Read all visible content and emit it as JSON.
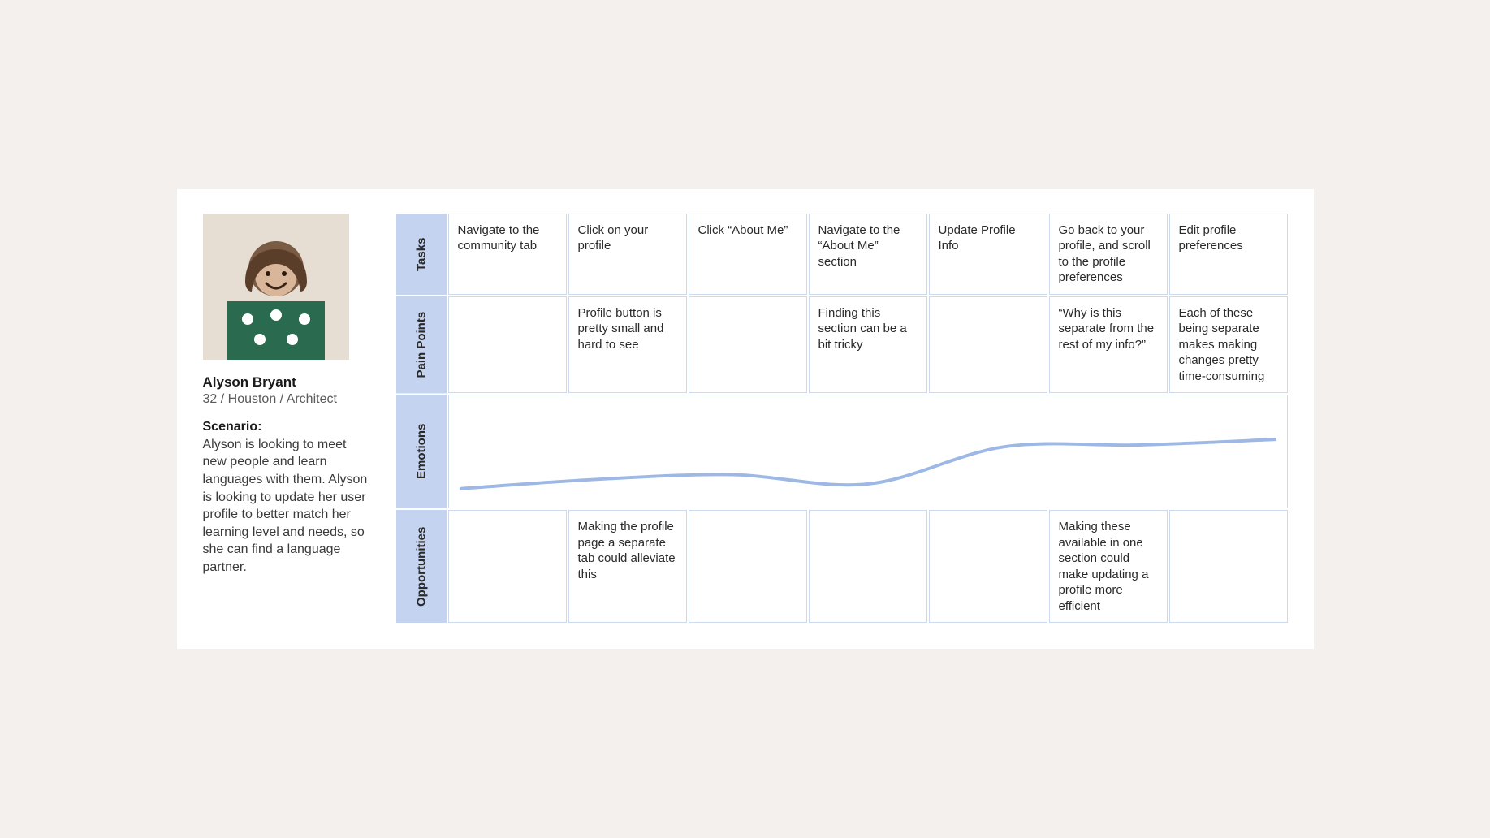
{
  "persona": {
    "name": "Alyson Bryant",
    "meta": "32 / Houston / Architect",
    "scenario_label": "Scenario:",
    "scenario_text": "Alyson is looking to meet new people and learn languages with them. Alyson is looking to update her user profile to better match her learning level and needs, so she can find a language partner."
  },
  "rows": {
    "tasks_label": "Tasks",
    "pain_label": "Pain Points",
    "emotions_label": "Emotions",
    "opportunities_label": "Opportunities"
  },
  "columns": [
    {
      "task": "Navigate to the community tab",
      "pain": "",
      "opportunity": ""
    },
    {
      "task": "Click on your profile",
      "pain": "Profile button is pretty small and hard to see",
      "opportunity": "Making the profile page a separate tab could alleviate this"
    },
    {
      "task": "Click “About Me”",
      "pain": "",
      "opportunity": ""
    },
    {
      "task": "Navigate to the “About Me” section",
      "pain": "Finding this section can be a bit tricky",
      "opportunity": ""
    },
    {
      "task": "Update Profile Info",
      "pain": "",
      "opportunity": ""
    },
    {
      "task": "Go back to your profile, and scroll to the profile preferences",
      "pain": "“Why is this separate from the rest of my info?”",
      "opportunity": "Making these available in one section could make updating a profile more efficient"
    },
    {
      "task": "Edit profile preferences",
      "pain": "Each of these being separate makes making changes pretty time-consuming",
      "opportunity": ""
    }
  ],
  "chart_data": {
    "type": "line",
    "title": "Emotions",
    "xlabel": "",
    "ylabel": "",
    "x": [
      0,
      1,
      2,
      3,
      4,
      5,
      6
    ],
    "values": [
      10,
      20,
      25,
      15,
      55,
      57,
      63
    ],
    "ylim": [
      0,
      100
    ],
    "grid": false,
    "note": "Emotional journey curve across the seven task steps; y is a relative sentiment estimate with higher = more positive."
  }
}
